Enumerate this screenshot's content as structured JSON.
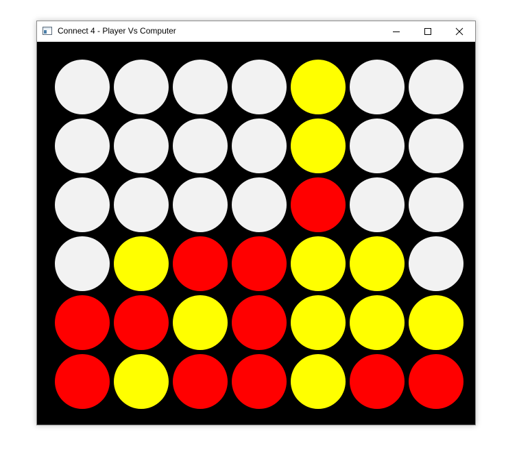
{
  "window": {
    "title": "Connect 4 - Player Vs Computer",
    "icon": "app-icon",
    "controls": [
      "minimize-icon",
      "maximize-icon",
      "close-icon"
    ]
  },
  "colors": {
    "board_background": "#000000",
    "empty": "#f2f2f2",
    "red": "#ff0000",
    "yellow": "#ffff00"
  },
  "board": {
    "columns": 7,
    "rows": 6,
    "grid": [
      [
        "empty",
        "empty",
        "empty",
        "empty",
        "yellow",
        "empty",
        "empty"
      ],
      [
        "empty",
        "empty",
        "empty",
        "empty",
        "yellow",
        "empty",
        "empty"
      ],
      [
        "empty",
        "empty",
        "empty",
        "empty",
        "red",
        "empty",
        "empty"
      ],
      [
        "empty",
        "yellow",
        "red",
        "red",
        "yellow",
        "yellow",
        "empty"
      ],
      [
        "red",
        "red",
        "yellow",
        "red",
        "yellow",
        "yellow",
        "yellow"
      ],
      [
        "red",
        "yellow",
        "red",
        "red",
        "yellow",
        "red",
        "red"
      ]
    ]
  }
}
